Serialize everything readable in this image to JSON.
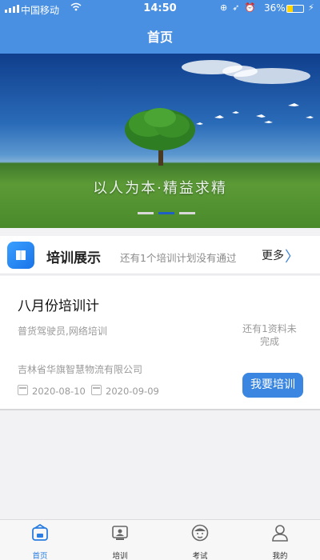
{
  "status_bar": {
    "carrier": "中国移动",
    "time": "14:50",
    "battery": "36%",
    "battery_level": 0.36
  },
  "header": {
    "title": "首页"
  },
  "banner": {
    "slogan": "以人为本·精益求精",
    "active_slide": 2,
    "slides": 3
  },
  "section": {
    "title": "培训展示",
    "notice": "还有1个培训计划没有通过",
    "more_label": "更多",
    "chevron_icon": "chevron-right-icon",
    "app_icon": "book-icon"
  },
  "card": {
    "title": "八月份培训计",
    "description": "普货驾驶员,网络培训",
    "status_line1": "还有1资料未",
    "status_line2": "完成",
    "company": "吉林省华旗智慧物流有限公司",
    "start_date": "2020-08-10",
    "end_date": "2020-09-09",
    "button_label": "我要培训"
  },
  "tabbar": {
    "items": [
      {
        "label": "首页",
        "icon": "home-icon"
      },
      {
        "label": "培训",
        "icon": "training-icon"
      },
      {
        "label": "考试",
        "icon": "exam-icon"
      },
      {
        "label": "我的",
        "icon": "profile-icon"
      }
    ],
    "active_color": "#2a7de1"
  },
  "colors": {
    "primary": "#4a90e2",
    "button": "#3a86e0",
    "battery": "#ffd400"
  }
}
